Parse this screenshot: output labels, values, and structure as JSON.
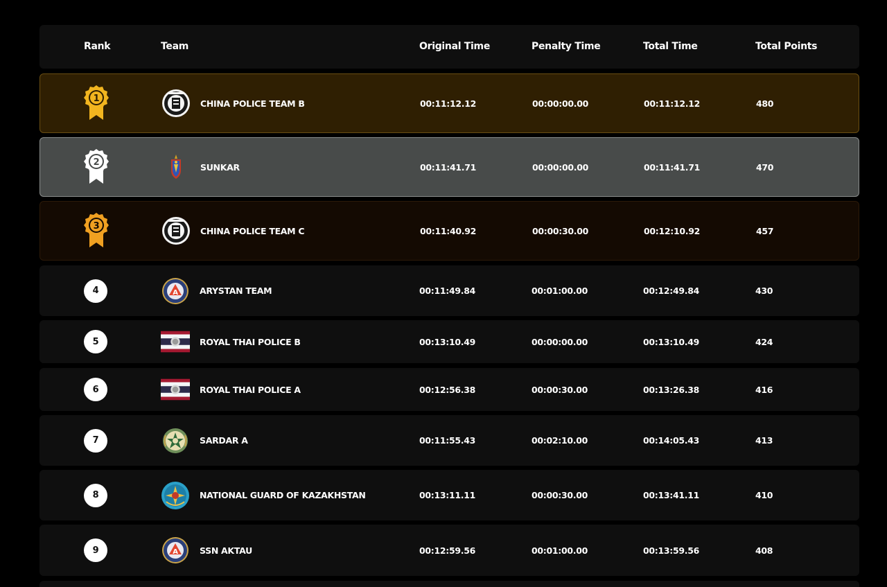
{
  "header": {
    "rank": "Rank",
    "team": "Team",
    "original_time": "Original Time",
    "penalty_time": "Penalty Time",
    "total_time": "Total Time",
    "total_points": "Total Points"
  },
  "colors": {
    "gold_row": "#2f1f02",
    "silver_row": "#484b4a",
    "bronze_row": "#140a02",
    "default_row": "#0f0f0f",
    "gold_medal": "#f2b51f",
    "silver_medal": "#ffffff",
    "bronze_medal": "#f0a021"
  },
  "rows": [
    {
      "rank": "1",
      "medal": "gold",
      "logo": "china-police-emblem-icon",
      "team": "CHINA POLICE TEAM B",
      "original_time": "00:11:12.12",
      "penalty_time": "00:00:00.00",
      "total_time": "00:11:12.12",
      "points": "480"
    },
    {
      "rank": "2",
      "medal": "silver",
      "logo": "sunkar-emblem-icon",
      "team": "SUNKAR",
      "original_time": "00:11:41.71",
      "penalty_time": "00:00:00.00",
      "total_time": "00:11:41.71",
      "points": "470"
    },
    {
      "rank": "3",
      "medal": "bronze",
      "logo": "china-police-emblem-icon",
      "team": "CHINA POLICE TEAM C",
      "original_time": "00:11:40.92",
      "penalty_time": "00:00:30.00",
      "total_time": "00:12:10.92",
      "points": "457"
    },
    {
      "rank": "4",
      "medal": "",
      "logo": "arystan-emblem-icon",
      "team": "ARYSTAN TEAM",
      "original_time": "00:11:49.84",
      "penalty_time": "00:01:00.00",
      "total_time": "00:12:49.84",
      "points": "430"
    },
    {
      "rank": "5",
      "medal": "",
      "logo": "royal-thai-police-flag-icon",
      "team": "ROYAL THAI POLICE B",
      "original_time": "00:13:10.49",
      "penalty_time": "00:00:00.00",
      "total_time": "00:13:10.49",
      "points": "424"
    },
    {
      "rank": "6",
      "medal": "",
      "logo": "royal-thai-police-flag-icon",
      "team": "ROYAL THAI POLICE A",
      "original_time": "00:12:56.38",
      "penalty_time": "00:00:30.00",
      "total_time": "00:13:26.38",
      "points": "416"
    },
    {
      "rank": "7",
      "medal": "",
      "logo": "sardar-emblem-icon",
      "team": "SARDAR A",
      "original_time": "00:11:55.43",
      "penalty_time": "00:02:10.00",
      "total_time": "00:14:05.43",
      "points": "413"
    },
    {
      "rank": "8",
      "medal": "",
      "logo": "national-guard-emblem-icon",
      "team": "NATIONAL GUARD OF KAZAKHSTAN",
      "original_time": "00:13:11.11",
      "penalty_time": "00:00:30.00",
      "total_time": "00:13:41.11",
      "points": "410"
    },
    {
      "rank": "9",
      "medal": "",
      "logo": "arystan-emblem-icon",
      "team": "SSN AKTAU",
      "original_time": "00:12:59.56",
      "penalty_time": "00:01:00.00",
      "total_time": "00:13:59.56",
      "points": "408"
    }
  ]
}
